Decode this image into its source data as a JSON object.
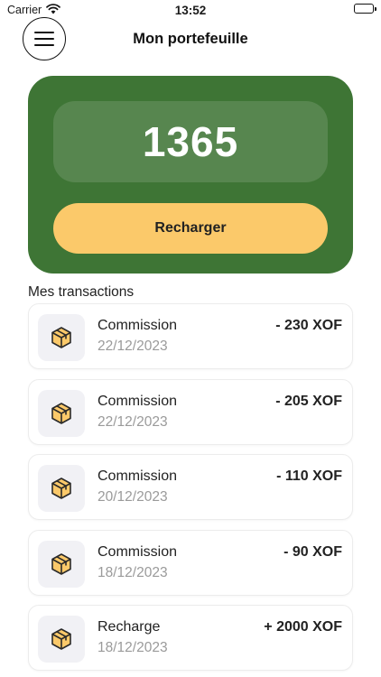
{
  "status_bar": {
    "carrier": "Carrier",
    "time": "13:52"
  },
  "header": {
    "title": "Mon portefeuille"
  },
  "wallet": {
    "balance": "1365",
    "recharge_label": "Recharger"
  },
  "transactions_section": {
    "title": "Mes transactions"
  },
  "transactions": [
    {
      "title": "Commission",
      "date": "22/12/2023",
      "amount": "- 230 XOF"
    },
    {
      "title": "Commission",
      "date": "22/12/2023",
      "amount": "- 205 XOF"
    },
    {
      "title": "Commission",
      "date": "20/12/2023",
      "amount": "- 110 XOF"
    },
    {
      "title": "Commission",
      "date": "18/12/2023",
      "amount": "- 90 XOF"
    },
    {
      "title": "Recharge",
      "date": "18/12/2023",
      "amount": "+ 2000 XOF"
    }
  ],
  "colors": {
    "card_green": "#3e7535",
    "button_yellow": "#fbc96a",
    "icon_box_bg": "#f1f1f5",
    "date_gray": "#9a9a9a"
  },
  "icons": {
    "menu": "hamburger-icon",
    "transaction": "package-box-icon"
  }
}
